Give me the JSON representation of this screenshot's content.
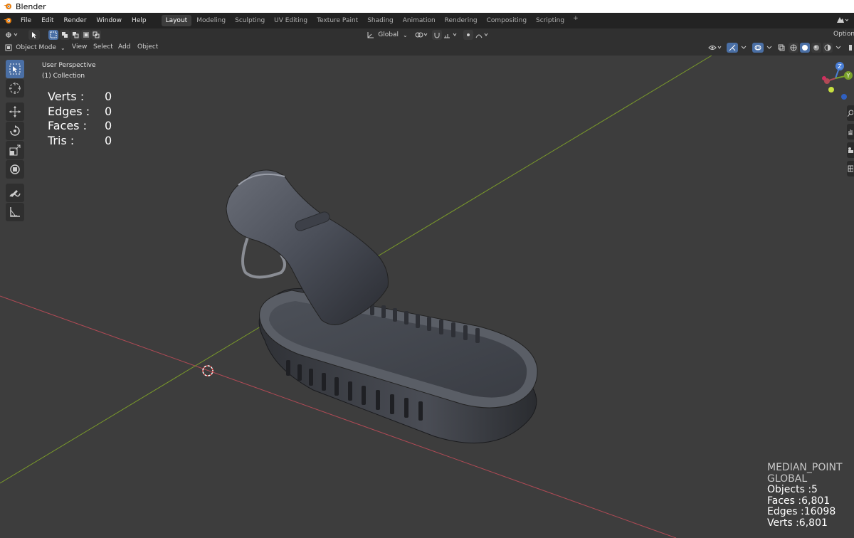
{
  "window": {
    "title": "Blender"
  },
  "menubar": {
    "menus": [
      "File",
      "Edit",
      "Render",
      "Window",
      "Help"
    ],
    "workspaces": [
      {
        "label": "Layout",
        "active": true
      },
      {
        "label": "Modeling",
        "active": false
      },
      {
        "label": "Sculpting",
        "active": false
      },
      {
        "label": "UV Editing",
        "active": false
      },
      {
        "label": "Texture Paint",
        "active": false
      },
      {
        "label": "Shading",
        "active": false
      },
      {
        "label": "Animation",
        "active": false
      },
      {
        "label": "Rendering",
        "active": false
      },
      {
        "label": "Compositing",
        "active": false
      },
      {
        "label": "Scripting",
        "active": false
      }
    ],
    "add_workspace": "+"
  },
  "tool_header": {
    "orientation": "Global",
    "options": "Options"
  },
  "viewport_header": {
    "mode": "Object Mode",
    "menus": [
      "View",
      "Select",
      "Add",
      "Object"
    ]
  },
  "viewport": {
    "view_name": "User Perspective",
    "collection": "(1) Collection",
    "stats": [
      {
        "label": "Verts :",
        "value": "0"
      },
      {
        "label": "Edges :",
        "value": "0"
      },
      {
        "label": "Faces :",
        "value": "0"
      },
      {
        "label": "Tris :",
        "value": "0"
      }
    ],
    "overlay_text": {
      "pivot": "MEDIAN_POINT",
      "orientation": "GLOBAL",
      "objects": "Objects :5",
      "faces": "Faces :6,801",
      "edges": "Edges :16098",
      "verts": "Verts :6,801"
    }
  },
  "gizmo": {
    "z": "Z",
    "y": "Y"
  },
  "colors": {
    "x_axis": "#b04a55",
    "y_axis": "#7a9a2a",
    "accent": "#4a6fa5",
    "viewport_bg": "#3d3d3d"
  },
  "tools": [
    "select-box-icon",
    "cursor-icon",
    "move-icon",
    "rotate-icon",
    "scale-icon",
    "transform-icon",
    "annotate-icon",
    "measure-icon"
  ]
}
